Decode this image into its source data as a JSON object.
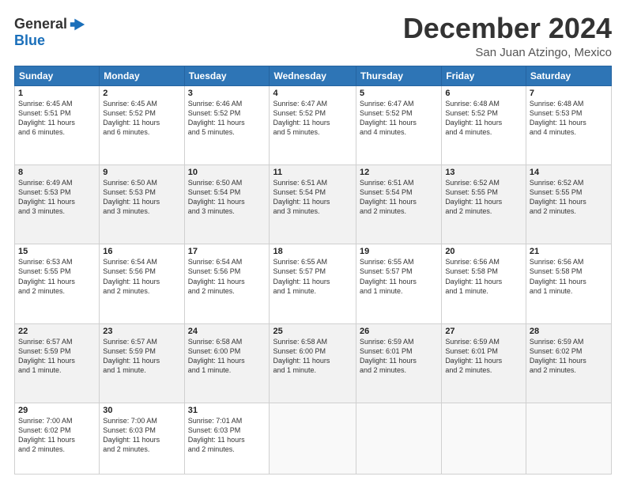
{
  "logo": {
    "line1": "General",
    "line2": "Blue"
  },
  "title": "December 2024",
  "subtitle": "San Juan Atzingo, Mexico",
  "headers": [
    "Sunday",
    "Monday",
    "Tuesday",
    "Wednesday",
    "Thursday",
    "Friday",
    "Saturday"
  ],
  "weeks": [
    [
      {
        "day": "1",
        "info": "Sunrise: 6:45 AM\nSunset: 5:51 PM\nDaylight: 11 hours\nand 6 minutes."
      },
      {
        "day": "2",
        "info": "Sunrise: 6:45 AM\nSunset: 5:52 PM\nDaylight: 11 hours\nand 6 minutes."
      },
      {
        "day": "3",
        "info": "Sunrise: 6:46 AM\nSunset: 5:52 PM\nDaylight: 11 hours\nand 5 minutes."
      },
      {
        "day": "4",
        "info": "Sunrise: 6:47 AM\nSunset: 5:52 PM\nDaylight: 11 hours\nand 5 minutes."
      },
      {
        "day": "5",
        "info": "Sunrise: 6:47 AM\nSunset: 5:52 PM\nDaylight: 11 hours\nand 4 minutes."
      },
      {
        "day": "6",
        "info": "Sunrise: 6:48 AM\nSunset: 5:52 PM\nDaylight: 11 hours\nand 4 minutes."
      },
      {
        "day": "7",
        "info": "Sunrise: 6:48 AM\nSunset: 5:53 PM\nDaylight: 11 hours\nand 4 minutes."
      }
    ],
    [
      {
        "day": "8",
        "info": "Sunrise: 6:49 AM\nSunset: 5:53 PM\nDaylight: 11 hours\nand 3 minutes."
      },
      {
        "day": "9",
        "info": "Sunrise: 6:50 AM\nSunset: 5:53 PM\nDaylight: 11 hours\nand 3 minutes."
      },
      {
        "day": "10",
        "info": "Sunrise: 6:50 AM\nSunset: 5:54 PM\nDaylight: 11 hours\nand 3 minutes."
      },
      {
        "day": "11",
        "info": "Sunrise: 6:51 AM\nSunset: 5:54 PM\nDaylight: 11 hours\nand 3 minutes."
      },
      {
        "day": "12",
        "info": "Sunrise: 6:51 AM\nSunset: 5:54 PM\nDaylight: 11 hours\nand 2 minutes."
      },
      {
        "day": "13",
        "info": "Sunrise: 6:52 AM\nSunset: 5:55 PM\nDaylight: 11 hours\nand 2 minutes."
      },
      {
        "day": "14",
        "info": "Sunrise: 6:52 AM\nSunset: 5:55 PM\nDaylight: 11 hours\nand 2 minutes."
      }
    ],
    [
      {
        "day": "15",
        "info": "Sunrise: 6:53 AM\nSunset: 5:55 PM\nDaylight: 11 hours\nand 2 minutes."
      },
      {
        "day": "16",
        "info": "Sunrise: 6:54 AM\nSunset: 5:56 PM\nDaylight: 11 hours\nand 2 minutes."
      },
      {
        "day": "17",
        "info": "Sunrise: 6:54 AM\nSunset: 5:56 PM\nDaylight: 11 hours\nand 2 minutes."
      },
      {
        "day": "18",
        "info": "Sunrise: 6:55 AM\nSunset: 5:57 PM\nDaylight: 11 hours\nand 1 minute."
      },
      {
        "day": "19",
        "info": "Sunrise: 6:55 AM\nSunset: 5:57 PM\nDaylight: 11 hours\nand 1 minute."
      },
      {
        "day": "20",
        "info": "Sunrise: 6:56 AM\nSunset: 5:58 PM\nDaylight: 11 hours\nand 1 minute."
      },
      {
        "day": "21",
        "info": "Sunrise: 6:56 AM\nSunset: 5:58 PM\nDaylight: 11 hours\nand 1 minute."
      }
    ],
    [
      {
        "day": "22",
        "info": "Sunrise: 6:57 AM\nSunset: 5:59 PM\nDaylight: 11 hours\nand 1 minute."
      },
      {
        "day": "23",
        "info": "Sunrise: 6:57 AM\nSunset: 5:59 PM\nDaylight: 11 hours\nand 1 minute."
      },
      {
        "day": "24",
        "info": "Sunrise: 6:58 AM\nSunset: 6:00 PM\nDaylight: 11 hours\nand 1 minute."
      },
      {
        "day": "25",
        "info": "Sunrise: 6:58 AM\nSunset: 6:00 PM\nDaylight: 11 hours\nand 1 minute."
      },
      {
        "day": "26",
        "info": "Sunrise: 6:59 AM\nSunset: 6:01 PM\nDaylight: 11 hours\nand 2 minutes."
      },
      {
        "day": "27",
        "info": "Sunrise: 6:59 AM\nSunset: 6:01 PM\nDaylight: 11 hours\nand 2 minutes."
      },
      {
        "day": "28",
        "info": "Sunrise: 6:59 AM\nSunset: 6:02 PM\nDaylight: 11 hours\nand 2 minutes."
      }
    ],
    [
      {
        "day": "29",
        "info": "Sunrise: 7:00 AM\nSunset: 6:02 PM\nDaylight: 11 hours\nand 2 minutes."
      },
      {
        "day": "30",
        "info": "Sunrise: 7:00 AM\nSunset: 6:03 PM\nDaylight: 11 hours\nand 2 minutes."
      },
      {
        "day": "31",
        "info": "Sunrise: 7:01 AM\nSunset: 6:03 PM\nDaylight: 11 hours\nand 2 minutes."
      },
      {
        "day": "",
        "info": ""
      },
      {
        "day": "",
        "info": ""
      },
      {
        "day": "",
        "info": ""
      },
      {
        "day": "",
        "info": ""
      }
    ]
  ]
}
